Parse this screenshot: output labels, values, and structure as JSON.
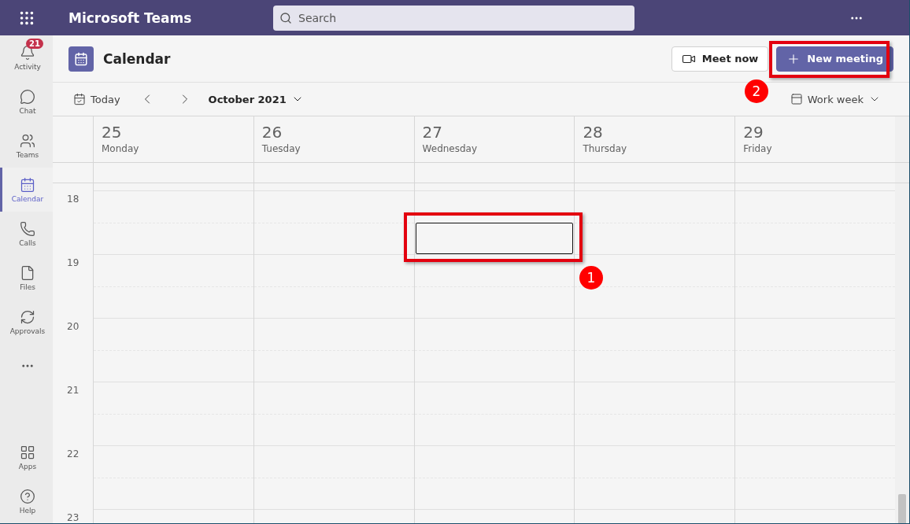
{
  "app_bar": {
    "title": "Microsoft Teams",
    "search": {
      "placeholder": "Search"
    }
  },
  "sidebar": {
    "items": [
      {
        "label": "Activity",
        "selected": false,
        "badge": "21"
      },
      {
        "label": "Chat",
        "selected": false
      },
      {
        "label": "Teams",
        "selected": false
      },
      {
        "label": "Calendar",
        "selected": true
      },
      {
        "label": "Calls",
        "selected": false
      },
      {
        "label": "Files",
        "selected": false
      },
      {
        "label": "Approvals",
        "selected": false
      }
    ],
    "bottom_items": [
      {
        "label": "Apps",
        "selected": false
      },
      {
        "label": "Help",
        "selected": false
      }
    ]
  },
  "header": {
    "title": "Calendar",
    "buttons": [
      {
        "label": "Meet now",
        "kind": "secondary"
      },
      {
        "label": "New meeting",
        "kind": "primary"
      }
    ]
  },
  "toolbar": {
    "today": "Today",
    "month": "October 2021",
    "view": "Work week"
  },
  "days": [
    {
      "date": "25",
      "weekday": "Monday",
      "has_selection": false
    },
    {
      "date": "26",
      "weekday": "Tuesday",
      "has_selection": false
    },
    {
      "date": "27",
      "weekday": "Wednesday",
      "has_selection": true
    },
    {
      "date": "28",
      "weekday": "Thursday",
      "has_selection": false
    },
    {
      "date": "29",
      "weekday": "Friday",
      "has_selection": false
    }
  ],
  "hours": [
    "18",
    "19",
    "20",
    "21",
    "22",
    "23"
  ],
  "callouts": [
    {
      "number": "1"
    },
    {
      "number": "2"
    }
  ]
}
